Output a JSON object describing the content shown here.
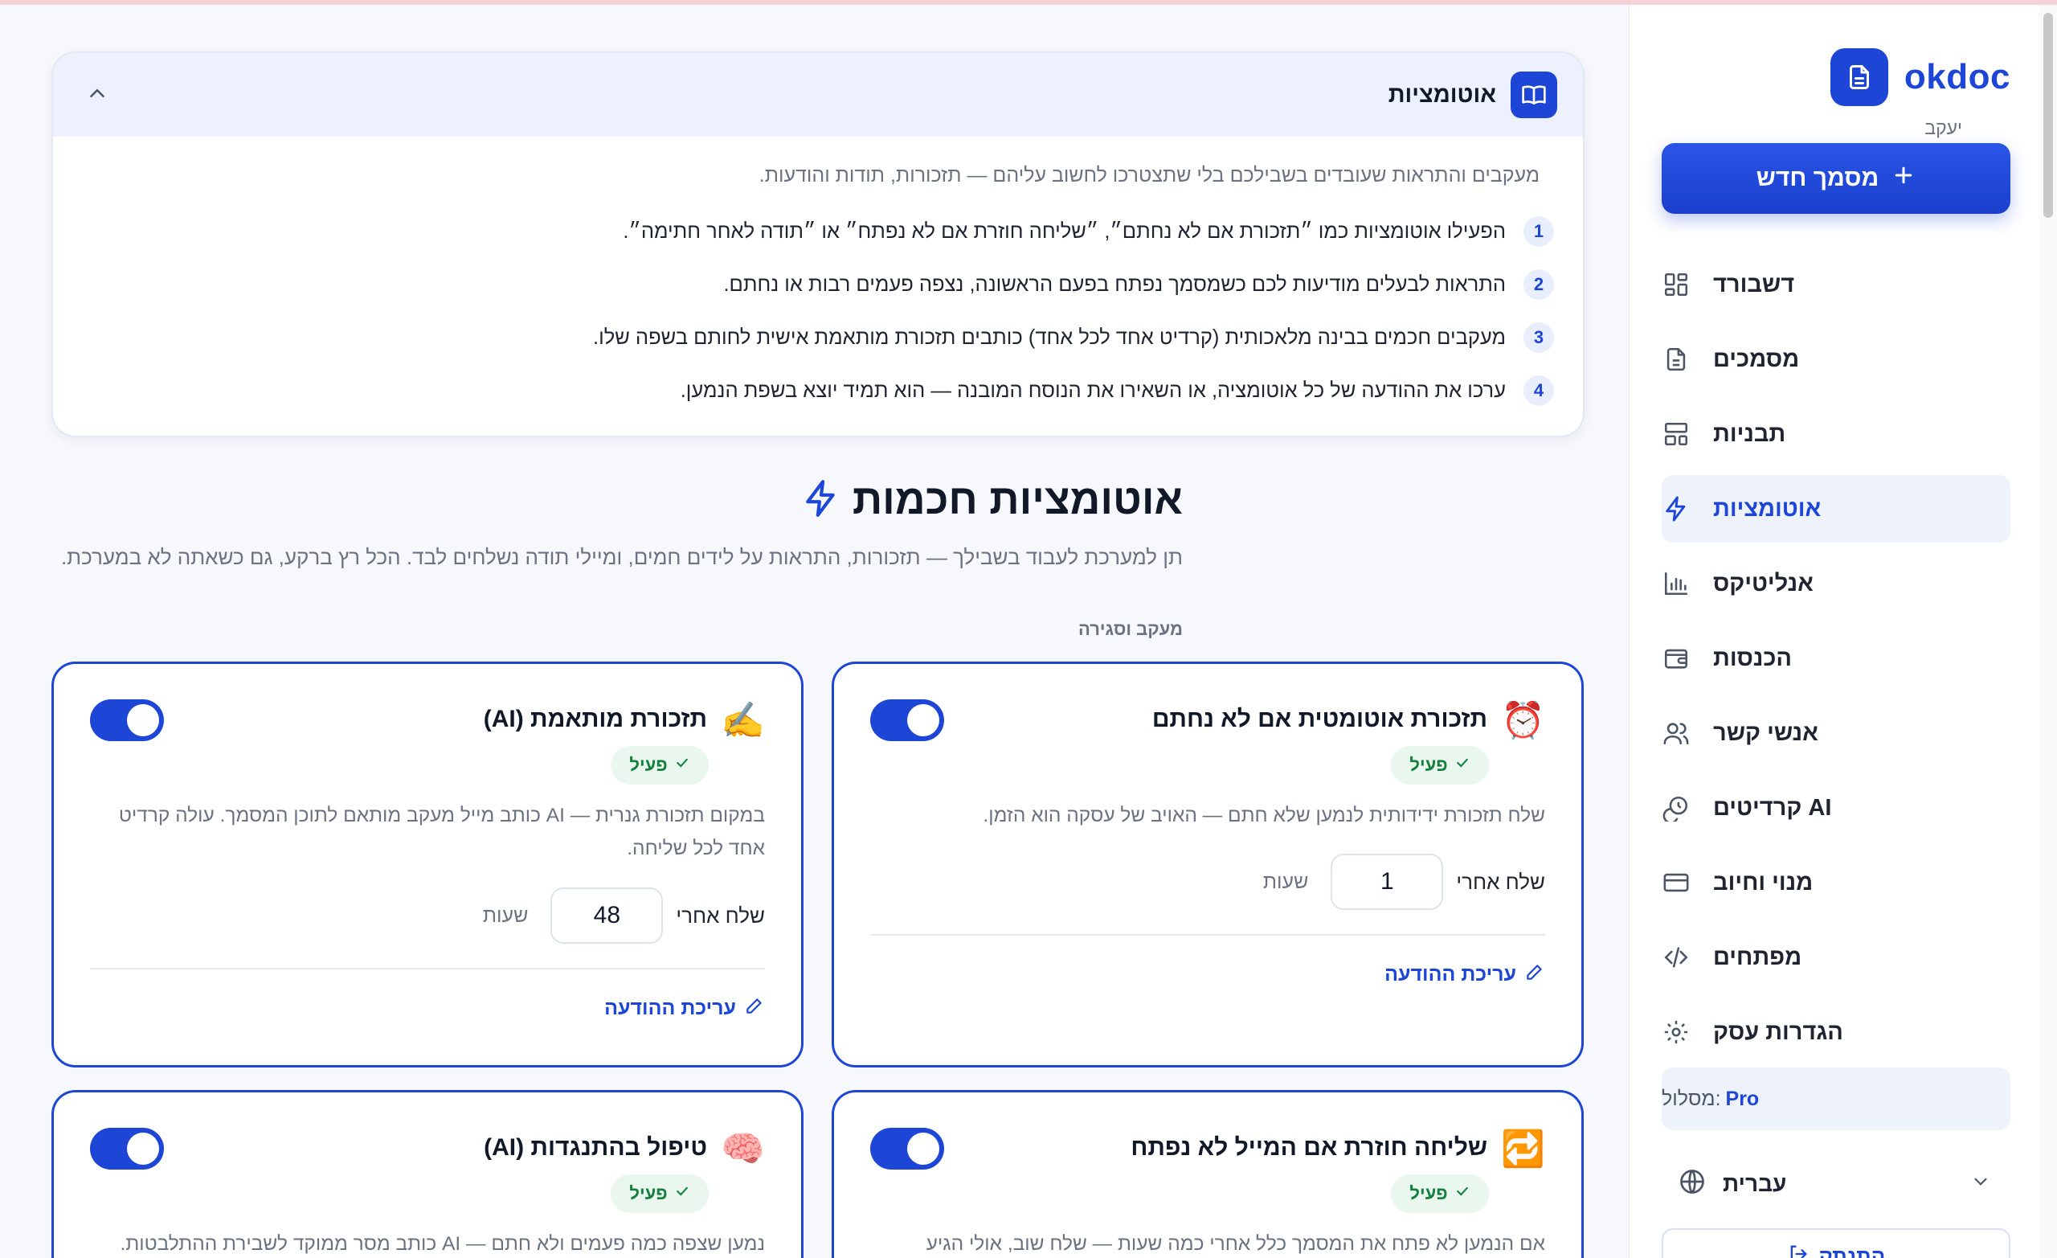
{
  "sidebar": {
    "brand": "okdoc",
    "user": "יעקב",
    "new_doc": "מסמך חדש",
    "items": [
      {
        "label": "דשבורד",
        "icon": "dashboard-icon"
      },
      {
        "label": "מסמכים",
        "icon": "document-icon"
      },
      {
        "label": "תבניות",
        "icon": "templates-icon"
      },
      {
        "label": "אוטומציות",
        "icon": "lightning-icon",
        "active": true
      },
      {
        "label": "אנליטיקס",
        "icon": "bar-chart-icon"
      },
      {
        "label": "הכנסות",
        "icon": "wallet-icon"
      },
      {
        "label": "אנשי קשר",
        "icon": "users-icon"
      },
      {
        "label": "קרדיטים AI",
        "icon": "credits-icon"
      },
      {
        "label": "מנוי וחיוב",
        "icon": "credit-card-icon"
      },
      {
        "label": "מפתחים",
        "icon": "code-icon"
      },
      {
        "label": "הגדרות עסק",
        "icon": "gear-icon"
      }
    ],
    "plan_label": "מסלול:",
    "plan_value": "Pro",
    "language": "עברית",
    "logout": "התנתק"
  },
  "guide": {
    "title": "אוטומציות",
    "intro": "מעקבים והתראות שעובדים בשבילכם בלי שתצטרכו לחשוב עליהם — תזכורות, תודות והודעות.",
    "steps": [
      {
        "n": "1",
        "text": "הפעילו אוטומציות כמו ״תזכורת אם לא נחתם״, ״שליחה חוזרת אם לא נפתח״ או ״תודה לאחר חתימה״."
      },
      {
        "n": "2",
        "text": "התראות לבעלים מודיעות לכם כשמסמך נפתח בפעם הראשונה, נצפה פעמים רבות או נחתם."
      },
      {
        "n": "3",
        "text": "מעקבים חכמים בבינה מלאכותית (קרדיט אחד לכל אחד) כותבים תזכורת מותאמת אישית לחותם בשפה שלו."
      },
      {
        "n": "4",
        "text": "ערכו את ההודעה של כל אוטומציה, או השאירו את הנוסח המובנה — הוא תמיד יוצא בשפת הנמען."
      }
    ]
  },
  "section": {
    "title": "אוטומציות חכמות",
    "desc": "תן למערכת לעבוד בשבילך — תזכורות, התראות על לידים חמים, ומיילי תודה נשלחים לבד. הכל רץ ברקע, גם כשאתה לא במערכת.",
    "group": "מעקב וסגירה"
  },
  "cards": [
    {
      "emoji": "⏰",
      "title": "תזכורת אוטומטית אם לא נחתם",
      "status": "פעיל",
      "enabled": true,
      "desc": "שלח תזכורת ידידותית לנמען שלא חתם — האויב של עסקה הוא הזמן.",
      "send_label": "שלח אחרי",
      "value": "1",
      "unit": "שעות",
      "edit": "עריכת ההודעה"
    },
    {
      "emoji": "✍️",
      "title": "תזכורת מותאמת (AI)",
      "status": "פעיל",
      "enabled": true,
      "desc": "במקום תזכורת גנרית — AI כותב מייל מעקב מותאם לתוכן המסמך. עולה קרדיט אחד לכל שליחה.",
      "send_label": "שלח אחרי",
      "value": "48",
      "unit": "שעות",
      "edit": "עריכת ההודעה"
    },
    {
      "emoji": "🔁",
      "title": "שליחה חוזרת אם המייל לא נפתח",
      "status": "פעיל",
      "enabled": true,
      "desc": "אם הנמען לא פתח את המסמך כלל אחרי כמה שעות — שלח שוב, אולי הגיע"
    },
    {
      "emoji": "🧠",
      "title": "טיפול בהתנגדות (AI)",
      "status": "פעיל",
      "enabled": true,
      "desc": "נמען שצפה כמה פעמים ולא חתם — AI כותב מסר ממוקד לשבירת ההתלבטות."
    }
  ]
}
